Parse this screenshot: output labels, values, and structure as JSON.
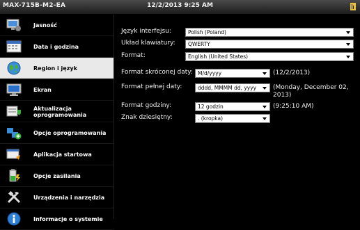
{
  "titlebar": {
    "device": "MAX-715B-M2-EA",
    "datetime": "12/2/2013 9:25 AM",
    "status_icon": "signal-bar-icon"
  },
  "sidebar": {
    "selected_index": 2,
    "items": [
      {
        "label": "Jasność",
        "icon": "monitor-brightness-icon"
      },
      {
        "label": "Data i godzina",
        "icon": "calendar-icon"
      },
      {
        "label": "Region i język",
        "icon": "globe-icon"
      },
      {
        "label": "Ekran",
        "icon": "display-icon"
      },
      {
        "label": "Aktualizacja oprogramowania",
        "icon": "download-update-icon"
      },
      {
        "label": "Opcje oprogramowania",
        "icon": "puzzle-add-icon"
      },
      {
        "label": "Aplikacja startowa",
        "icon": "startup-app-icon"
      },
      {
        "label": "Opcje zasilania",
        "icon": "battery-power-icon"
      },
      {
        "label": "Urządzenia i narzędzia",
        "icon": "tools-icon"
      },
      {
        "label": "Informacje o systemie",
        "icon": "info-icon"
      }
    ]
  },
  "language": {
    "label": "Język interfejsu:",
    "value": "Polish (Poland)"
  },
  "keyboard": {
    "label": "Układ klawiatury:",
    "value": "QWERTY"
  },
  "format": {
    "label": "Format:",
    "value": "English (United States)"
  },
  "short_date": {
    "label": "Format skróconej daty:",
    "value": "M/d/yyyy",
    "example": "(12/2/2013)"
  },
  "long_date": {
    "label": "Format pełnej daty:",
    "value": "dddd, MMMM dd, yyyy",
    "example_line1": "(Monday, December 02,",
    "example_line2": "2013)"
  },
  "time": {
    "label": "Format godziny:",
    "value": "12 godzin",
    "example": "(9:25:10 AM)"
  },
  "decimal": {
    "label": "Znak dziesiętny:",
    "value": ". (kropka)"
  }
}
